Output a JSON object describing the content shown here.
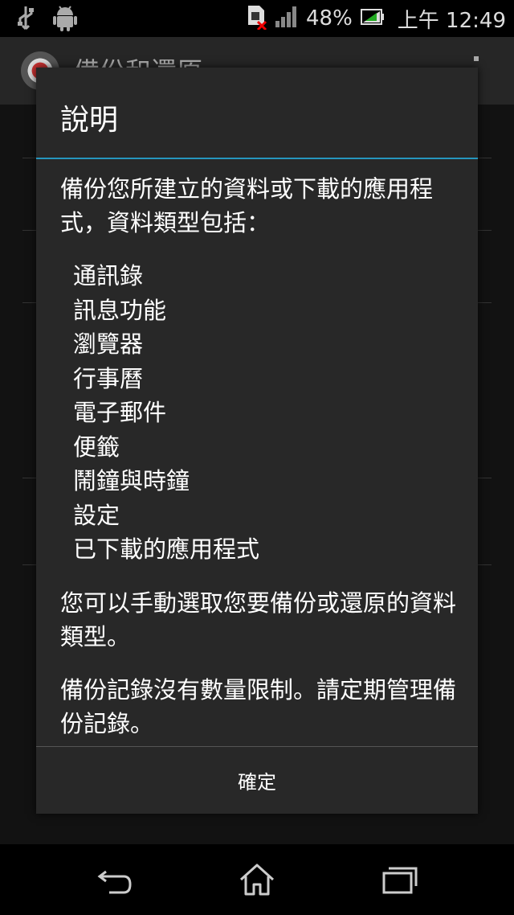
{
  "status_bar": {
    "battery_percent": "48%",
    "time": "上午 12:49",
    "icons": [
      "usb-icon",
      "android-icon",
      "sim-error-icon",
      "signal-icon",
      "battery-charging-icon"
    ]
  },
  "background_app": {
    "title": "備份和還原"
  },
  "dialog": {
    "title": "說明",
    "intro": "備份您所建立的資料或下載的應用程式，資料類型包括：",
    "data_types": [
      "通訊錄",
      "訊息功能",
      "瀏覽器",
      "行事曆",
      "電子郵件",
      "便籤",
      "鬧鐘與時鐘",
      "設定",
      "已下載的應用程式"
    ],
    "paragraph2": "您可以手動選取您要備份或還原的資料類型。",
    "paragraph3": "備份記錄沒有數量限制。請定期管理備份記錄。",
    "ok_label": "確定"
  },
  "nav_bar": {
    "buttons": [
      "back-icon",
      "home-icon",
      "recent-apps-icon"
    ]
  },
  "colors": {
    "accent": "#2596be",
    "dialog_bg": "#282828"
  }
}
